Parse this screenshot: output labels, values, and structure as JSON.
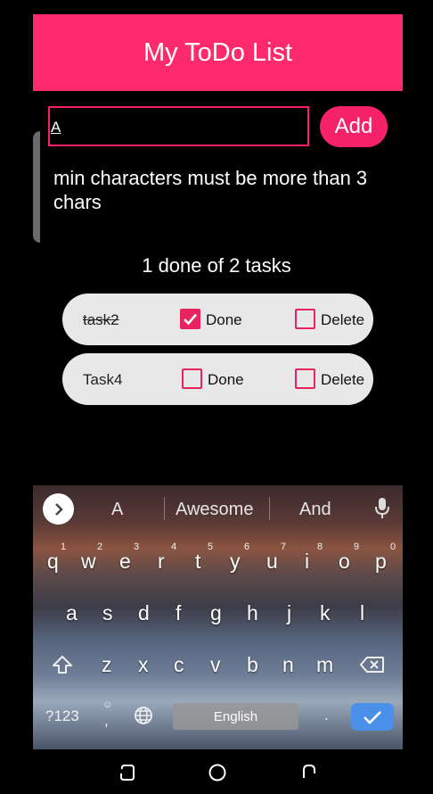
{
  "header": {
    "title": "My ToDo List"
  },
  "input": {
    "value": "A",
    "add_label": "Add"
  },
  "error": {
    "message": "min characters must be more than 3 chars"
  },
  "summary": {
    "text": "1 done of 2 tasks"
  },
  "tasks": [
    {
      "name": "task2",
      "done": true,
      "done_label": "Done",
      "delete_label": "Delete",
      "delete_checked": false
    },
    {
      "name": "Task4",
      "done": false,
      "done_label": "Done",
      "delete_label": "Delete",
      "delete_checked": false
    }
  ],
  "keyboard": {
    "suggestions": [
      "A",
      "Awesome",
      "And"
    ],
    "row1": [
      "q",
      "w",
      "e",
      "r",
      "t",
      "y",
      "u",
      "i",
      "o",
      "p"
    ],
    "row1_numbers": [
      "1",
      "2",
      "3",
      "4",
      "5",
      "6",
      "7",
      "8",
      "9",
      "0"
    ],
    "row2": [
      "a",
      "s",
      "d",
      "f",
      "g",
      "h",
      "j",
      "k",
      "l"
    ],
    "row3": [
      "z",
      "x",
      "c",
      "v",
      "b",
      "n",
      "m"
    ],
    "symbols_label": "?123",
    "comma": ",",
    "emoji_hint": "☺",
    "space_label": "English",
    "period": "."
  },
  "colors": {
    "accent": "#ff2a6d",
    "enter": "#4a8fe8"
  },
  "icons": {
    "checkbox-checked": "check-icon",
    "keyboard-expand": "chevron-right-icon",
    "voice": "mic-icon",
    "shift": "shift-icon",
    "backspace": "backspace-icon",
    "language": "globe-icon",
    "enter": "check-icon"
  }
}
